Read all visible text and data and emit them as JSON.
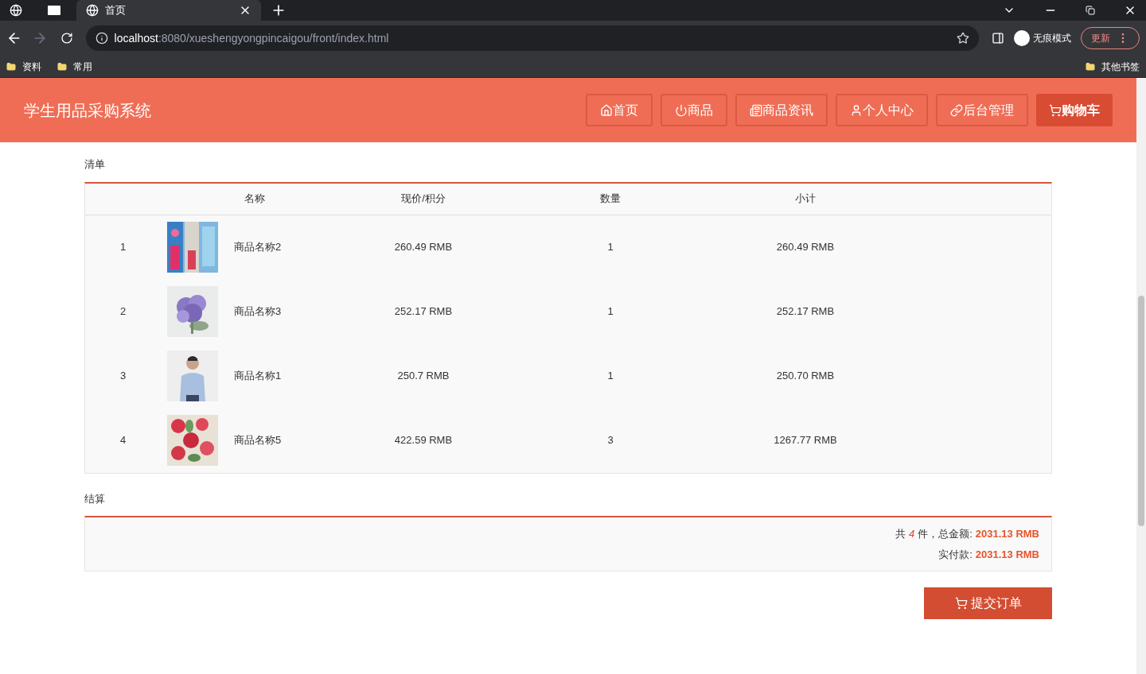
{
  "browser": {
    "tabs": [
      {
        "title": "首页",
        "selected": true
      }
    ],
    "url_host": "localhost",
    "url_path": ":8080/xueshengyongpincaigou/front/index.html",
    "profile": "无痕模式",
    "update": "更新",
    "bookmarks": [
      "资料",
      "常用"
    ],
    "other_bookmarks": "其他书签"
  },
  "header": {
    "title": "学生用品采购系统",
    "nav": [
      {
        "label": "首页",
        "selected": false
      },
      {
        "label": "商品",
        "selected": false
      },
      {
        "label": "商品资讯",
        "selected": false
      },
      {
        "label": "个人中心",
        "selected": false
      },
      {
        "label": "后台管理",
        "selected": false
      },
      {
        "label": "购物车",
        "selected": true
      }
    ]
  },
  "list": {
    "title": "清单",
    "columns": [
      "名称",
      "现价/积分",
      "数量",
      "小计"
    ],
    "rows": [
      {
        "index": "1",
        "name": "商品名称2",
        "price": "260.49 RMB",
        "qty": "1",
        "subtotal": "260.49 RMB"
      },
      {
        "index": "2",
        "name": "商品名称3",
        "price": "252.17 RMB",
        "qty": "1",
        "subtotal": "252.17 RMB"
      },
      {
        "index": "3",
        "name": "商品名称1",
        "price": "250.7 RMB",
        "qty": "1",
        "subtotal": "250.70 RMB"
      },
      {
        "index": "4",
        "name": "商品名称5",
        "price": "422.59 RMB",
        "qty": "3",
        "subtotal": "1267.77 RMB"
      }
    ]
  },
  "checkout": {
    "title": "结算",
    "count_prefix": "共",
    "count": "4",
    "count_suffix": "件，总金额:",
    "total": "2031.13 RMB",
    "paid_label": "实付款:",
    "paid": "2031.13 RMB",
    "submit": "提交订单"
  }
}
